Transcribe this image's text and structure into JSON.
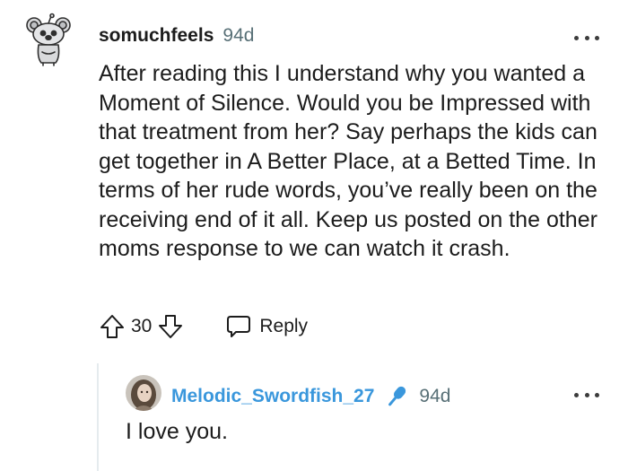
{
  "comment": {
    "username": "somuchfeels",
    "age": "94d",
    "body": "After reading this I understand why you wanted a Moment of Silence. Would you be Impressed with that treatment from her? Say perhaps the kids can get together in A Better Place, at a Betted Time. In terms of her rude words, you’ve really been on the receiving end of it all. Keep us posted on the other moms response to we can watch it crash.",
    "score": "30",
    "reply_label": "Reply"
  },
  "reply": {
    "username": "Melodic_Swordfish_27",
    "age": "94d",
    "body": "I love you."
  },
  "colors": {
    "text": "#1c1c1c",
    "meta": "#576f76",
    "reply_username": "#3a97dc",
    "thread_line": "#e5ebee"
  },
  "icons": {
    "main_avatar": "snoo-koala-avatar-icon",
    "upvote": "arrow-up-icon",
    "downvote": "arrow-down-icon",
    "reply": "speech-bubble-icon",
    "more": "more-horizontal-icon",
    "flair": "microphone-icon"
  }
}
